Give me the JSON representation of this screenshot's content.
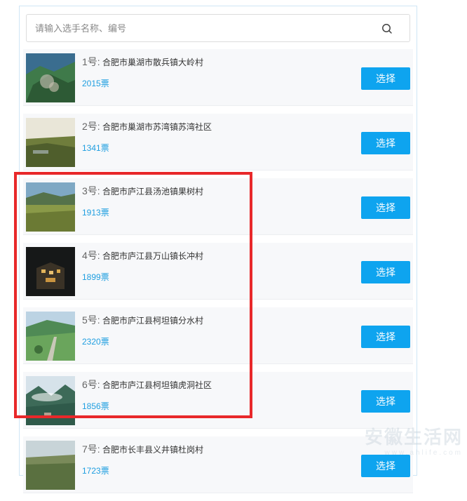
{
  "search": {
    "placeholder": "请输入选手名称、编号"
  },
  "button_label": "选择",
  "accent_color": "#0ea4ef",
  "highlight_color": "#e8282a",
  "entries": [
    {
      "num": "1号:",
      "name": "合肥市巢湖市散兵镇大岭村",
      "votes": "2015票"
    },
    {
      "num": "2号:",
      "name": "合肥市巢湖市苏湾镇苏湾社区",
      "votes": "1341票"
    },
    {
      "num": "3号:",
      "name": "合肥市庐江县汤池镇果树村",
      "votes": "1913票"
    },
    {
      "num": "4号:",
      "name": "合肥市庐江县万山镇长冲村",
      "votes": "1899票"
    },
    {
      "num": "5号:",
      "name": "合肥市庐江县柯坦镇分水村",
      "votes": "2320票"
    },
    {
      "num": "6号:",
      "name": "合肥市庐江县柯坦镇虎洞社区",
      "votes": "1856票"
    },
    {
      "num": "7号:",
      "name": "合肥市长丰县义井镇杜岗村",
      "votes": "1723票"
    }
  ],
  "watermark": {
    "text": "安徽生活网",
    "url": "www.ahlife.com"
  }
}
